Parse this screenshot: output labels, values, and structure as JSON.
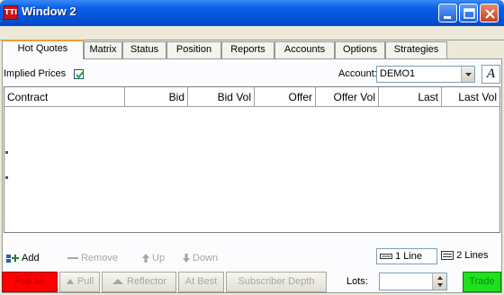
{
  "window": {
    "title": "Window 2",
    "app_icon_text": "TTI"
  },
  "tabs": [
    {
      "label": "Hot Quotes",
      "active": true
    },
    {
      "label": "Matrix"
    },
    {
      "label": "Status"
    },
    {
      "label": "Position"
    },
    {
      "label": "Reports"
    },
    {
      "label": "Accounts"
    },
    {
      "label": "Options"
    },
    {
      "label": "Strategies"
    }
  ],
  "toolbar": {
    "implied_prices_label": "Implied Prices",
    "implied_prices_checked": true,
    "account_label": "Account:",
    "account_value": "DEMO1",
    "font_button_label": "A"
  },
  "grid": {
    "columns": [
      "Contract",
      "Bid",
      "Bid Vol",
      "Offer",
      "Offer Vol",
      "Last",
      "Last Vol"
    ],
    "rows": []
  },
  "actions": {
    "add": "Add",
    "remove": "Remove",
    "up": "Up",
    "down": "Down",
    "one_line": "1 Line",
    "two_lines": "2 Lines"
  },
  "bottom": {
    "pull_all": "Pull All",
    "pull": "Pull",
    "reflector": "Reflector",
    "at_best": "At Best",
    "subscriber_depth": "Subscriber Depth",
    "lots_label": "Lots:",
    "lots_value": "",
    "trade": "Trade"
  },
  "colors": {
    "title_bar": "#0553d8",
    "pull_all_bg": "#ff0000",
    "trade_bg": "#1ee01e",
    "active_tab_accent": "#e8a131"
  }
}
